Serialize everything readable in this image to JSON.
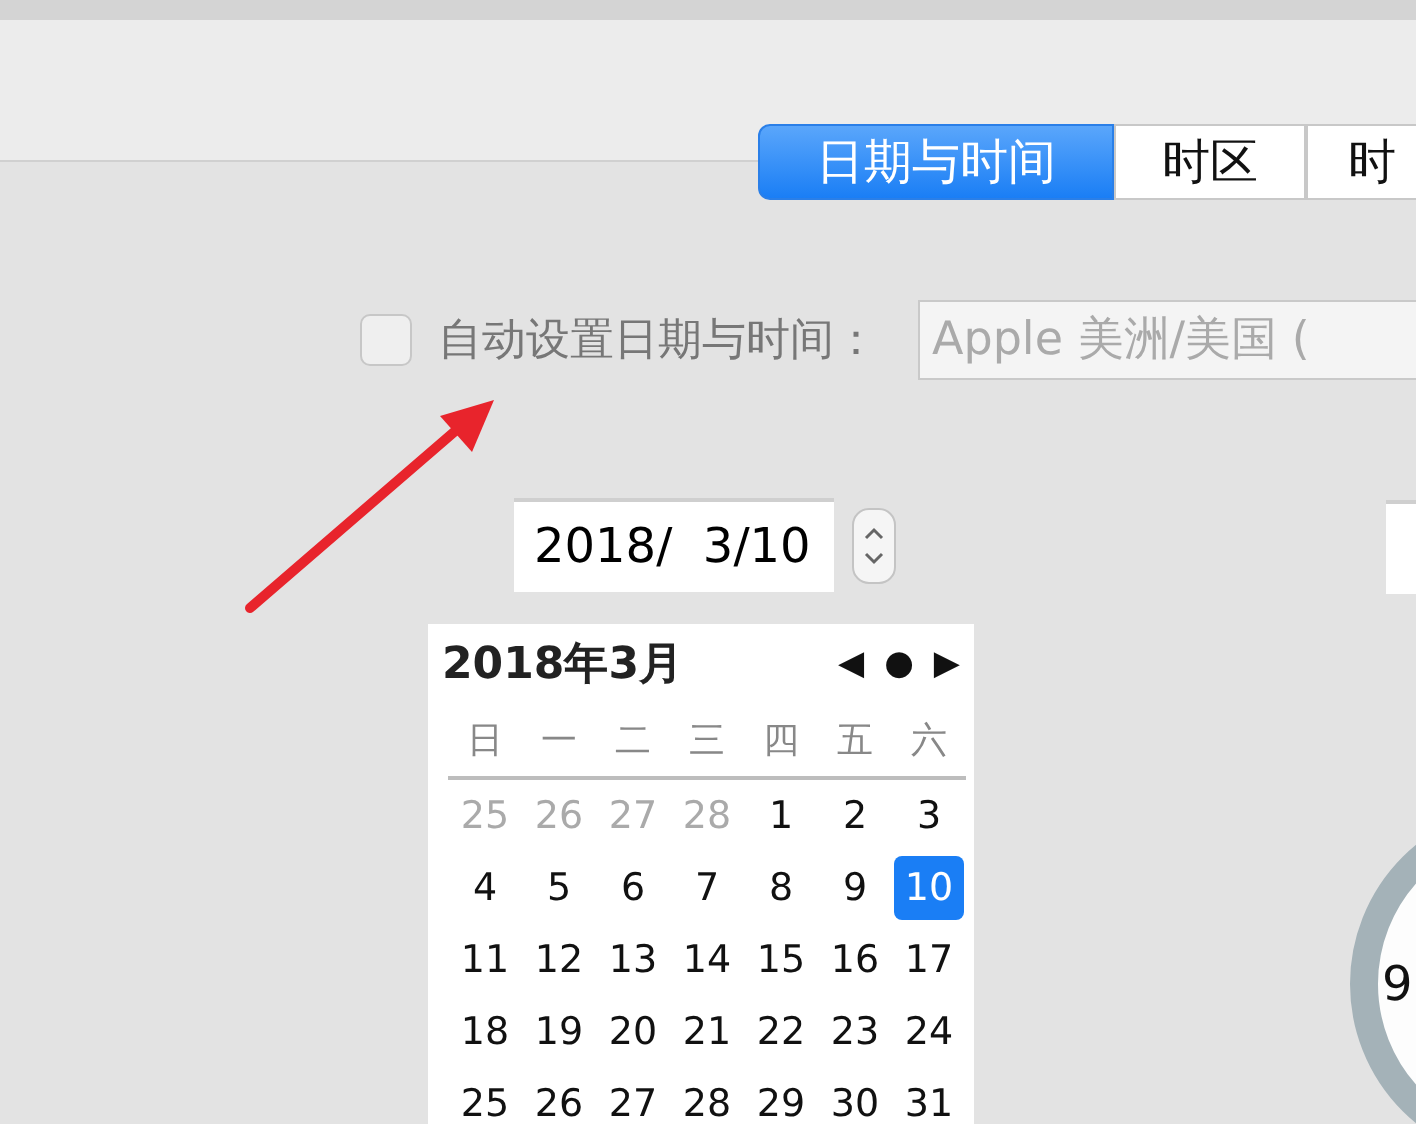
{
  "tabs": [
    {
      "label": "日期与时间",
      "selected": true
    },
    {
      "label": "时区",
      "selected": false
    },
    {
      "label": "时",
      "selected": false
    }
  ],
  "auto_set": {
    "label": "自动设置日期与时间：",
    "checked": false,
    "disabled": true
  },
  "time_server": {
    "value": "Apple 美洲/美国 ("
  },
  "date_field": {
    "value": "2018/  3/10"
  },
  "calendar": {
    "title": "2018年3月",
    "prev": "◀",
    "today": "●",
    "next": "▶",
    "weekdays": [
      "日",
      "一",
      "二",
      "三",
      "四",
      "五",
      "六"
    ],
    "weeks": [
      [
        {
          "day": "25",
          "muted": true,
          "selected": false
        },
        {
          "day": "26",
          "muted": true,
          "selected": false
        },
        {
          "day": "27",
          "muted": true,
          "selected": false
        },
        {
          "day": "28",
          "muted": true,
          "selected": false
        },
        {
          "day": "1",
          "muted": false,
          "selected": false
        },
        {
          "day": "2",
          "muted": false,
          "selected": false
        },
        {
          "day": "3",
          "muted": false,
          "selected": false
        }
      ],
      [
        {
          "day": "4",
          "muted": false,
          "selected": false
        },
        {
          "day": "5",
          "muted": false,
          "selected": false
        },
        {
          "day": "6",
          "muted": false,
          "selected": false
        },
        {
          "day": "7",
          "muted": false,
          "selected": false
        },
        {
          "day": "8",
          "muted": false,
          "selected": false
        },
        {
          "day": "9",
          "muted": false,
          "selected": false
        },
        {
          "day": "10",
          "muted": false,
          "selected": true
        }
      ],
      [
        {
          "day": "11",
          "muted": false,
          "selected": false
        },
        {
          "day": "12",
          "muted": false,
          "selected": false
        },
        {
          "day": "13",
          "muted": false,
          "selected": false
        },
        {
          "day": "14",
          "muted": false,
          "selected": false
        },
        {
          "day": "15",
          "muted": false,
          "selected": false
        },
        {
          "day": "16",
          "muted": false,
          "selected": false
        },
        {
          "day": "17",
          "muted": false,
          "selected": false
        }
      ],
      [
        {
          "day": "18",
          "muted": false,
          "selected": false
        },
        {
          "day": "19",
          "muted": false,
          "selected": false
        },
        {
          "day": "20",
          "muted": false,
          "selected": false
        },
        {
          "day": "21",
          "muted": false,
          "selected": false
        },
        {
          "day": "22",
          "muted": false,
          "selected": false
        },
        {
          "day": "23",
          "muted": false,
          "selected": false
        },
        {
          "day": "24",
          "muted": false,
          "selected": false
        }
      ],
      [
        {
          "day": "25",
          "muted": false,
          "selected": false
        },
        {
          "day": "26",
          "muted": false,
          "selected": false
        },
        {
          "day": "27",
          "muted": false,
          "selected": false
        },
        {
          "day": "28",
          "muted": false,
          "selected": false
        },
        {
          "day": "29",
          "muted": false,
          "selected": false
        },
        {
          "day": "30",
          "muted": false,
          "selected": false
        },
        {
          "day": "31",
          "muted": false,
          "selected": false
        }
      ]
    ]
  },
  "clock": {
    "numeral": "9"
  }
}
